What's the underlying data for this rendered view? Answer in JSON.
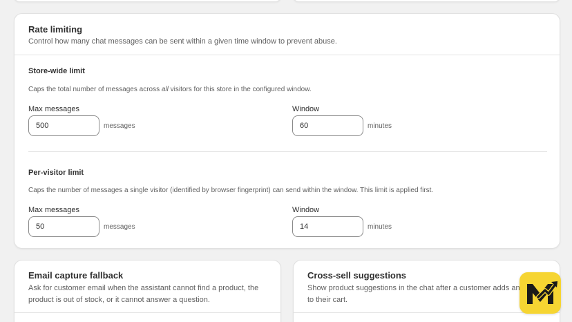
{
  "rate_limiting": {
    "title": "Rate limiting",
    "description": "Control how many chat messages can be sent within a given time window to prevent abuse.",
    "store_wide": {
      "title": "Store-wide limit",
      "desc_before": "Caps the total number of messages across ",
      "desc_emphasis": "all",
      "desc_after": " visitors for this store in the configured window.",
      "max_label": "Max messages",
      "max_value": "500",
      "max_suffix": "messages",
      "window_label": "Window",
      "window_value": "60",
      "window_suffix": "minutes"
    },
    "per_visitor": {
      "title": "Per-visitor limit",
      "description": "Caps the number of messages a single visitor (identified by browser fingerprint) can send within the window. This limit is applied first.",
      "max_label": "Max messages",
      "max_value": "50",
      "max_suffix": "messages",
      "window_label": "Window",
      "window_value": "14",
      "window_suffix": "minutes"
    }
  },
  "email_capture": {
    "title": "Email capture fallback",
    "description": "Ask for customer email when the assistant cannot find a product, the product is out of stock, or it cannot answer a question."
  },
  "cross_sell": {
    "title": "Cross-sell suggestions",
    "description": "Show product suggestions in the chat after a customer adds an item to their cart."
  },
  "logo": {
    "icon": "m-trend-logo",
    "background": "#f6d532"
  }
}
